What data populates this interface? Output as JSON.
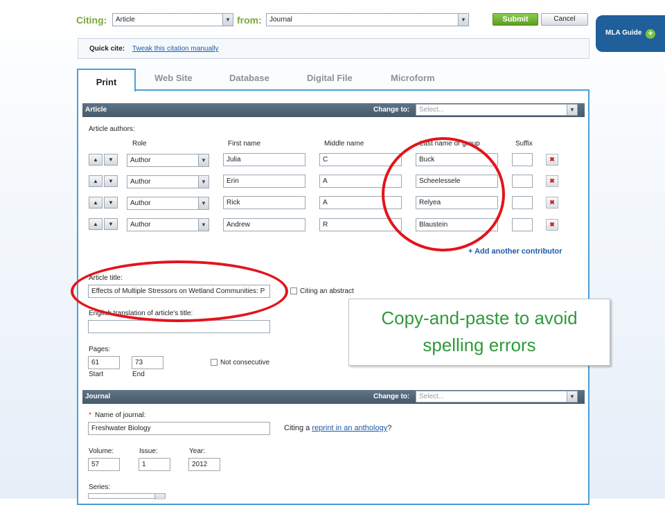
{
  "top": {
    "citing_label": "Citing:",
    "citing_value": "Article",
    "from_label": "from:",
    "from_value": "Journal",
    "submit_label": "Submit",
    "cancel_label": "Cancel"
  },
  "mla_guide": {
    "label": "MLA Guide",
    "plus": "+"
  },
  "quick_cite": {
    "label": "Quick cite:",
    "link": "Tweak this citation manually"
  },
  "tabs": [
    {
      "label": "Print"
    },
    {
      "label": "Web Site"
    },
    {
      "label": "Database"
    },
    {
      "label": "Digital File"
    },
    {
      "label": "Microform"
    }
  ],
  "article_section": {
    "title": "Article",
    "change_to_label": "Change to:",
    "change_to_placeholder": "Select...",
    "authors_label": "Article authors:",
    "columns": {
      "role": "Role",
      "first": "First name",
      "middle": "Middle name",
      "last": "Last name or group",
      "suffix": "Suffix"
    },
    "authors": [
      {
        "role": "Author",
        "first": "Julia",
        "middle": "C",
        "last": "Buck",
        "suffix": ""
      },
      {
        "role": "Author",
        "first": "Erin",
        "middle": "A",
        "last": "Scheelessele",
        "suffix": ""
      },
      {
        "role": "Author",
        "first": "Rick",
        "middle": "A",
        "last": "Relyea",
        "suffix": ""
      },
      {
        "role": "Author",
        "first": "Andrew",
        "middle": "R",
        "last": "Blaustein",
        "suffix": ""
      }
    ],
    "add_contributor": "+ Add another contributor",
    "article_title_label": "Article title:",
    "article_title_value": "Effects of Multiple Stressors on Wetland Communities: P",
    "citing_abstract": "Citing an abstract",
    "translation_label": "English translation of article's title:",
    "translation_value": "",
    "pages_label": "Pages:",
    "pages_start": "61",
    "pages_end": "73",
    "start_label": "Start",
    "end_label": "End",
    "not_consecutive": "Not consecutive"
  },
  "journal_section": {
    "title": "Journal",
    "change_to_label": "Change to:",
    "change_to_placeholder": "Select...",
    "required_marker": "*",
    "name_label": "Name of journal:",
    "name_value": "Freshwater Biology",
    "reprint_prefix": "Citing a",
    "reprint_link": "reprint in an anthology",
    "reprint_suffix": "?",
    "volume_label": "Volume:",
    "volume_value": "57",
    "issue_label": "Issue:",
    "issue_value": "1",
    "year_label": "Year:",
    "year_value": "2012",
    "series_label": "Series:"
  },
  "callout": {
    "line1": "Copy-and-paste to avoid",
    "line2": "spelling errors"
  },
  "icons": {
    "up": "▲",
    "down": "▼",
    "dropdown": "▼",
    "delete": "✖"
  },
  "colors": {
    "accent_green": "#7aa83a",
    "tab_blue": "#4b9fd6",
    "section_bar": "#52667a",
    "highlight_red": "#e3141c",
    "callout_green": "#2f9a3a",
    "link_blue": "#1e5aa8"
  }
}
